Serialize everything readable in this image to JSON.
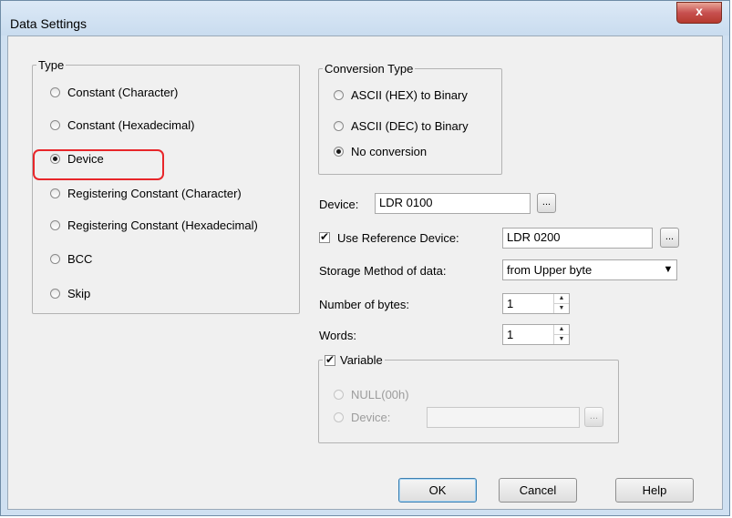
{
  "window": {
    "title": "Data Settings",
    "close_glyph": "x"
  },
  "type_group": {
    "legend": "Type",
    "options": [
      {
        "label": "Constant (Character)",
        "selected": false
      },
      {
        "label": "Constant (Hexadecimal)",
        "selected": false
      },
      {
        "label": "Device",
        "selected": true
      },
      {
        "label": "Registering Constant (Character)",
        "selected": false
      },
      {
        "label": "Registering Constant (Hexadecimal)",
        "selected": false
      },
      {
        "label": "BCC",
        "selected": false
      },
      {
        "label": "Skip",
        "selected": false
      }
    ]
  },
  "conversion_group": {
    "legend": "Conversion Type",
    "options": [
      {
        "label": "ASCII (HEX) to Binary",
        "selected": false
      },
      {
        "label": "ASCII (DEC) to Binary",
        "selected": false
      },
      {
        "label": "No conversion",
        "selected": true
      }
    ]
  },
  "device": {
    "label": "Device:",
    "value": "LDR 0100",
    "browse": "..."
  },
  "reference_device": {
    "label": "Use Reference Device:",
    "checked": true,
    "value": "LDR 0200",
    "browse": "..."
  },
  "storage_method": {
    "label": "Storage Method of data:",
    "value": "from Upper byte"
  },
  "number_of_bytes": {
    "label": "Number of bytes:",
    "value": "1"
  },
  "words": {
    "label": "Words:",
    "value": "1"
  },
  "variable_group": {
    "legend": "Variable",
    "checked": true,
    "null_option": "NULL(00h)",
    "device_option": "Device:",
    "device_value": "",
    "browse": "..."
  },
  "buttons": {
    "ok": "OK",
    "cancel": "Cancel",
    "help": "Help"
  },
  "highlight_color": "#e8262a"
}
